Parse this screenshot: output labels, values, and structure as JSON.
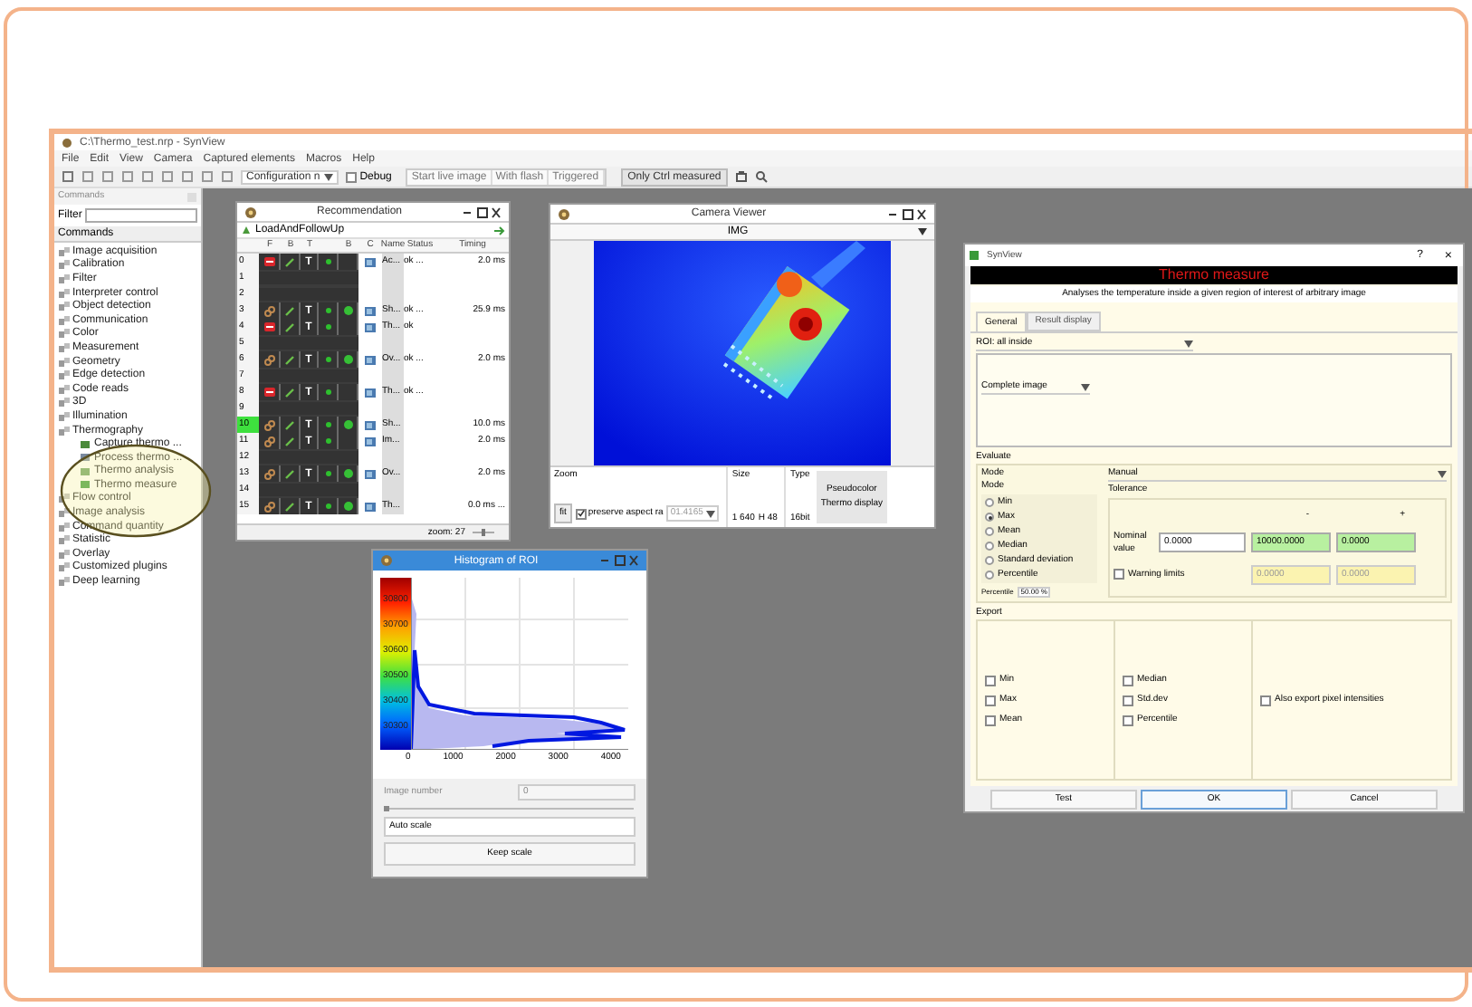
{
  "window": {
    "title": "C:\\Thermo_test.nrp - SynView"
  },
  "menu": [
    "File",
    "Edit",
    "View",
    "Camera",
    "Captured elements",
    "Macros",
    "Help"
  ],
  "toolbar": {
    "configuration": "Configuration n",
    "debug": {
      "label": "Debug",
      "checked": false
    },
    "buttons": [
      "Start live image",
      "With flash",
      "Triggered"
    ],
    "mode_button": "Only Ctrl measured"
  },
  "commands_panel": {
    "title": "Commands",
    "filter_label": "Filter",
    "header": "Commands",
    "items": [
      {
        "label": "Image acquisition"
      },
      {
        "label": "Calibration"
      },
      {
        "label": "Filter"
      },
      {
        "label": "Interpreter control"
      },
      {
        "label": "Object detection"
      },
      {
        "label": "Communication"
      },
      {
        "label": "Color"
      },
      {
        "label": "Measurement"
      },
      {
        "label": "Geometry"
      },
      {
        "label": "Edge detection"
      },
      {
        "label": "Code reads"
      },
      {
        "label": "3D"
      },
      {
        "label": "Illumination"
      },
      {
        "label": "Thermography",
        "children": [
          {
            "label": "Capture thermo ..."
          },
          {
            "label": "Process thermo ..."
          },
          {
            "label": "Thermo analysis"
          },
          {
            "label": "Thermo measure"
          }
        ]
      },
      {
        "label": "Flow control"
      },
      {
        "label": "Image analysis"
      },
      {
        "label": "Command quantity"
      },
      {
        "label": "Statistic"
      },
      {
        "label": "Overlay"
      },
      {
        "label": "Customized plugins"
      },
      {
        "label": "Deep learning"
      }
    ]
  },
  "recommendation": {
    "title": "Recommendation",
    "program": "LoadAndFollowUp",
    "columns": [
      "F",
      "B",
      "T",
      "B",
      "C",
      "Name",
      "Status",
      "Timing"
    ],
    "zoom": "zoom: 27",
    "rows": [
      {
        "index": "0",
        "selected": false,
        "kind": "stop",
        "tool": "T",
        "ring": false,
        "name": "Ac...",
        "status": "ok ...",
        "timing": "2.0 ms"
      },
      {
        "index": "1",
        "selected": false,
        "kind": "empty"
      },
      {
        "index": "2",
        "selected": false,
        "kind": "empty"
      },
      {
        "index": "3",
        "selected": false,
        "kind": "link",
        "tool": "T",
        "ring": true,
        "name": "Sh...",
        "status": "ok ...",
        "timing": "25.9 ms"
      },
      {
        "index": "4",
        "selected": false,
        "kind": "stop",
        "tool": "T",
        "ring": false,
        "name": "Th...",
        "status": "ok",
        "timing": ""
      },
      {
        "index": "5",
        "selected": false,
        "kind": "empty"
      },
      {
        "index": "6",
        "selected": false,
        "kind": "link",
        "tool": "T",
        "ring": true,
        "name": "Ov...",
        "status": "ok ...",
        "timing": "2.0 ms"
      },
      {
        "index": "7",
        "selected": false,
        "kind": "empty"
      },
      {
        "index": "8",
        "selected": false,
        "kind": "stop",
        "tool": "T",
        "ring": false,
        "name": "Th...",
        "status": "ok ...",
        "timing": ""
      },
      {
        "index": "9",
        "selected": false,
        "kind": "empty"
      },
      {
        "index": "10",
        "selected": true,
        "kind": "link",
        "tool": "T",
        "ring": true,
        "name": "Sh...",
        "status": "",
        "timing": "10.0 ms"
      },
      {
        "index": "11",
        "selected": false,
        "kind": "link",
        "tool": "T",
        "ring": false,
        "name": "Im...",
        "status": "",
        "timing": "2.0 ms"
      },
      {
        "index": "12",
        "selected": false,
        "kind": "empty"
      },
      {
        "index": "13",
        "selected": false,
        "kind": "link",
        "tool": "T",
        "ring": true,
        "name": "Ov...",
        "status": "",
        "timing": "2.0 ms"
      },
      {
        "index": "14",
        "selected": false,
        "kind": "empty"
      },
      {
        "index": "15",
        "selected": false,
        "kind": "link",
        "tool": "T",
        "ring": true,
        "name": "Th...",
        "status": "",
        "timing": "0.0 ms ..."
      }
    ]
  },
  "camera_viewer": {
    "title": "Camera Viewer",
    "source": "IMG",
    "zoom_label": "Zoom",
    "size_label": "Size",
    "type_label": "Type",
    "fit_button": "fit",
    "preserve": {
      "label": "preserve aspect ra",
      "checked": true
    },
    "ratio": "01.4165",
    "width": "1 640",
    "height": "H 48",
    "type": "16bit",
    "buttons": [
      "Pseudocolor",
      "Thermo display"
    ]
  },
  "histogram": {
    "title": "Histogram of ROI",
    "colorbar_labels": [
      "30800",
      "30700",
      "30600",
      "30500",
      "30400",
      "30300"
    ],
    "x_tick_labels": [
      "0",
      "1000",
      "2000",
      "3000",
      "4000"
    ],
    "image_number_label": "Image number",
    "image_number": "0",
    "scale_mode": "Auto scale",
    "keep_button": "Keep scale"
  },
  "dialog": {
    "title": "SynView",
    "help": "?",
    "close": "×",
    "banner": "Thermo measure",
    "description": "Analyses the temperature inside a given region of interest of arbitrary image",
    "tabs": [
      {
        "label": "General",
        "selected": true
      },
      {
        "label": "Result display",
        "selected": false
      }
    ],
    "roi_label": "ROI: all inside",
    "roi_value": "Complete image",
    "evaluate_label": "Evaluate",
    "mode_label": "Mode",
    "mode_value": "Manual",
    "mode_group_label": "Mode",
    "modes": [
      {
        "label": "Min",
        "selected": false
      },
      {
        "label": "Max",
        "selected": true
      },
      {
        "label": "Mean",
        "selected": false
      },
      {
        "label": "Median",
        "selected": false
      },
      {
        "label": "Standard deviation",
        "selected": false
      },
      {
        "label": "Percentile",
        "selected": false
      }
    ],
    "percentile_label": "Percentile",
    "percentile_value": "50.00 %",
    "tolerance_label": "Tolerance",
    "minus": "-",
    "plus": "+",
    "nominal_label": "Nominal value",
    "nominal_value": "0.0000",
    "tolerance_values": [
      "10000.0000",
      "0.0000"
    ],
    "warning": {
      "label": "Warning limits",
      "checked": false
    },
    "warning_values": [
      "0.0000",
      "0.0000"
    ],
    "export_label": "Export",
    "export": [
      {
        "label": "Min",
        "checked": false
      },
      {
        "label": "Max",
        "checked": false
      },
      {
        "label": "Mean",
        "checked": false
      },
      {
        "label": "Median",
        "checked": false
      },
      {
        "label": "Std.dev",
        "checked": false
      },
      {
        "label": "Percentile",
        "checked": false
      }
    ],
    "export_pixels": {
      "label": "Also export pixel intensities",
      "checked": false
    },
    "buttons": [
      "Test",
      "OK",
      "Cancel"
    ]
  }
}
